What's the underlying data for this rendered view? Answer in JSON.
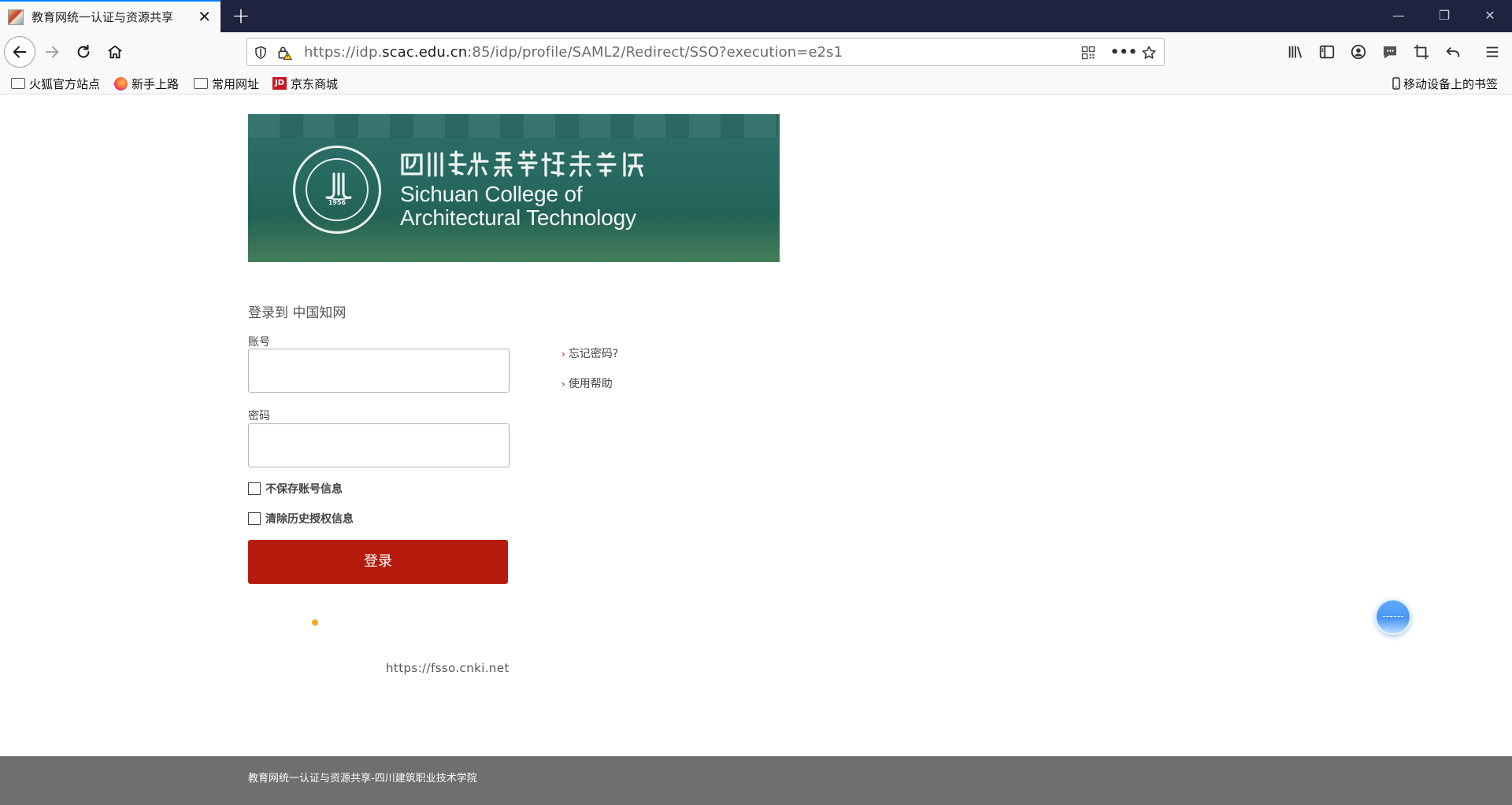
{
  "browser": {
    "tab": {
      "title": "教育网统一认证与资源共享",
      "close": "✕"
    },
    "new_tab": "+",
    "url": {
      "prefix": "https://idp.",
      "host": "scac.edu.cn",
      "suffix": ":85/idp/profile/SAML2/Redirect/SSO?execution=e2s1"
    },
    "page_actions": "•••",
    "window": {
      "minimize": "—",
      "restore": "❐",
      "close": "✕"
    }
  },
  "bookmarks": {
    "items": [
      {
        "label": "火狐官方站点",
        "icon": "folder-icon"
      },
      {
        "label": "新手上路",
        "icon": "firefox-icon"
      },
      {
        "label": "常用网址",
        "icon": "folder-icon"
      },
      {
        "label": "京东商城",
        "icon": "jd-icon"
      }
    ],
    "mobile": "移动设备上的书签",
    "jd_icon_text": "JD"
  },
  "banner": {
    "cn_name": "四川建筑职业技术学院",
    "en_line1": "Sichuan College of",
    "en_line2": "Architectural Technology",
    "year": "1956"
  },
  "login": {
    "title": "登录到 中国知网",
    "account_label": "账号",
    "password_label": "密码",
    "account_value": "",
    "password_value": "",
    "dont_save": "不保存账号信息",
    "clear_history": "清除历史授权信息",
    "submit": "登录",
    "forgot": "忘记密码?",
    "help": "使用帮助",
    "sp_url": "https://fsso.cnki.net"
  },
  "footer": {
    "text": "教育网统一认证与资源共享-四川建筑职业技术学院"
  },
  "colors": {
    "accent": "#b51b0c",
    "titlebar": "#202340",
    "tab_highlight": "#0a84ff",
    "footer": "#6f6f6f"
  }
}
